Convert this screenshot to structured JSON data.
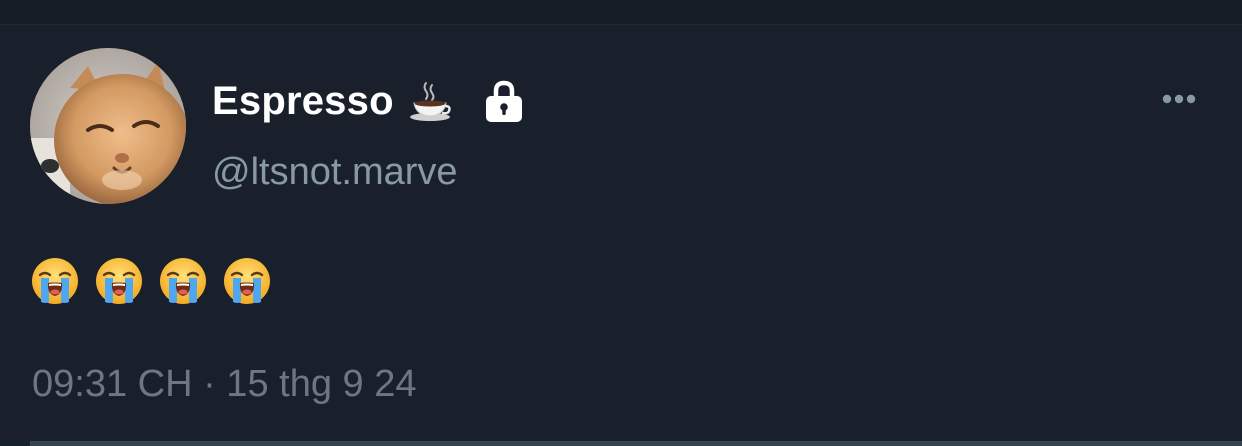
{
  "tweet": {
    "author": {
      "display_name": "Espresso",
      "name_emoji": "☕",
      "name_emoji_icon": "coffee-cup-icon",
      "protected_icon": "lock-icon",
      "handle": "@ltsnot.marve",
      "avatar_icon": "cat-avatar"
    },
    "text": "😭😭😭😭",
    "emoji_icon": "loudly-crying-face-icon",
    "timestamp": "09:31 CH · 15 thg 9 24"
  },
  "more_menu_icon": "more-horizontal-icon",
  "colors": {
    "background": "#1a202b",
    "primary_text": "#ffffff",
    "secondary_text": "#8899a6",
    "timestamp_text": "#6b7883",
    "divider": "#38444d"
  }
}
